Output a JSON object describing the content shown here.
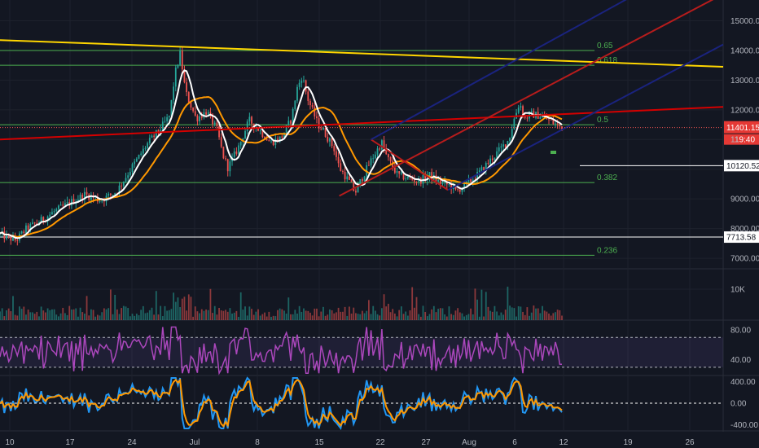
{
  "chart_data": [
    {
      "type": "candlestick",
      "panel": "price",
      "x_ticks": [
        "10",
        "17",
        "24",
        "Jul",
        "8",
        "15",
        "22",
        "27",
        "Aug",
        "6",
        "12",
        "19",
        "26"
      ],
      "y_ticks": [
        "15000.00",
        "14000.00",
        "13000.00",
        "12000.00",
        "11000.00",
        "10000.00",
        "9000.00",
        "8000.00",
        "7000.00"
      ],
      "ylim": [
        6700,
        15700
      ],
      "price_path": [
        [
          0,
          7800
        ],
        [
          3,
          7600
        ],
        [
          5,
          8000
        ],
        [
          8,
          8300
        ],
        [
          10,
          8550
        ],
        [
          13,
          8850
        ],
        [
          16,
          9150
        ],
        [
          19,
          8950
        ],
        [
          22,
          9250
        ],
        [
          25,
          10100
        ],
        [
          28,
          10900
        ],
        [
          30,
          11300
        ],
        [
          32,
          11800
        ],
        [
          33,
          13200
        ],
        [
          34,
          13900
        ],
        [
          35,
          12600
        ],
        [
          37,
          11700
        ],
        [
          39,
          11950
        ],
        [
          41,
          11300
        ],
        [
          42,
          10500
        ],
        [
          43,
          10050
        ],
        [
          45,
          10750
        ],
        [
          47,
          11650
        ],
        [
          49,
          11300
        ],
        [
          51,
          10900
        ],
        [
          53,
          11050
        ],
        [
          55,
          11700
        ],
        [
          56,
          12700
        ],
        [
          57,
          13150
        ],
        [
          58,
          12400
        ],
        [
          60,
          11500
        ],
        [
          61,
          11300
        ],
        [
          63,
          10700
        ],
        [
          64,
          10050
        ],
        [
          66,
          9550
        ],
        [
          67,
          9200
        ],
        [
          68,
          9600
        ],
        [
          70,
          10300
        ],
        [
          72,
          10900
        ],
        [
          73,
          10400
        ],
        [
          75,
          9800
        ],
        [
          77,
          9700
        ],
        [
          79,
          9600
        ],
        [
          81,
          9800
        ],
        [
          83,
          9550
        ],
        [
          85,
          9450
        ],
        [
          86,
          9250
        ],
        [
          88,
          9500
        ],
        [
          90,
          9800
        ],
        [
          92,
          10200
        ],
        [
          94,
          10600
        ],
        [
          96,
          11000
        ],
        [
          97,
          11700
        ],
        [
          98,
          12250
        ],
        [
          99,
          11700
        ],
        [
          100,
          11850
        ],
        [
          102,
          11800
        ],
        [
          104,
          11600
        ],
        [
          106,
          11400
        ]
      ],
      "last_price": "11401.15",
      "countdown": "19:40",
      "level_lines": [
        {
          "label": "10120.52",
          "value": 10120.52
        },
        {
          "label": "7713.58",
          "value": 7713.58
        }
      ],
      "fib_levels": [
        {
          "label": "0.65",
          "value": 14000
        },
        {
          "label": "0.618",
          "value": 13500
        },
        {
          "label": "0.5",
          "value": 11500
        },
        {
          "label": "0.382",
          "value": 9550
        },
        {
          "label": "0.236",
          "value": 7100
        }
      ],
      "colors": {
        "background": "#131722",
        "up": "#26a69a",
        "down": "#ef5350",
        "ma_fast": "#ffffff",
        "ma_slow": "#ff9800",
        "trend_yellow": "#ffd600",
        "trend_red": "#d50000",
        "channel_red": "#b71c1c",
        "channel_blue": "#1a237e",
        "fib": "#4caf50"
      }
    },
    {
      "type": "bar",
      "panel": "volume",
      "y_ticks": [
        "10K"
      ]
    },
    {
      "type": "line",
      "panel": "rsi",
      "y_ticks": [
        "80.00",
        "40.00"
      ],
      "ylim": [
        20,
        90
      ],
      "bands": [
        70,
        30
      ],
      "colors": {
        "line": "#ab47bc"
      }
    },
    {
      "type": "line",
      "panel": "oscillator",
      "y_ticks": [
        "400.00",
        "0.00",
        "-400.00"
      ],
      "ylim": [
        -500,
        500
      ],
      "colors": {
        "fast": "#2196f3",
        "slow": "#ff9800"
      }
    }
  ]
}
